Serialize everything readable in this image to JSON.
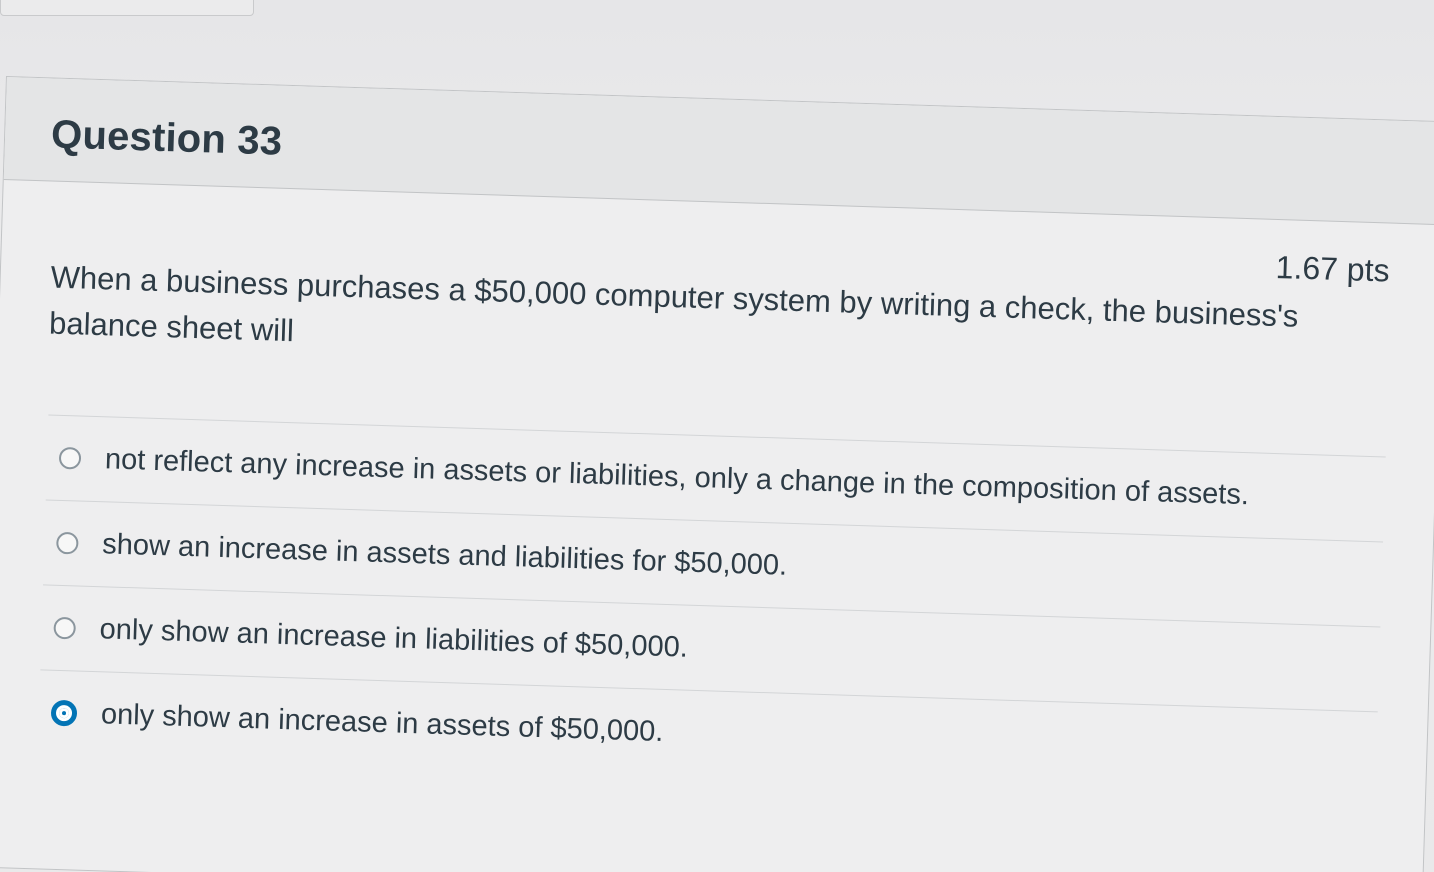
{
  "question": {
    "title": "Question 33",
    "points": "1.67 pts",
    "text": "When a business purchases a $50,000 computer system by writing a check, the business's balance sheet will"
  },
  "answers": [
    {
      "label": "not reflect any increase in assets or liabilities, only a change in the composition of assets.",
      "selected": false
    },
    {
      "label": "show an increase in assets and liabilities for $50,000.",
      "selected": false
    },
    {
      "label": "only show an increase in liabilities of $50,000.",
      "selected": false
    },
    {
      "label": "only show an increase in assets of $50,000.",
      "selected": true
    }
  ],
  "colors": {
    "text": "#2d3b45",
    "selected_radio": "#0374b5",
    "header_bg": "#e4e5e6",
    "border": "#c2c4c6"
  }
}
